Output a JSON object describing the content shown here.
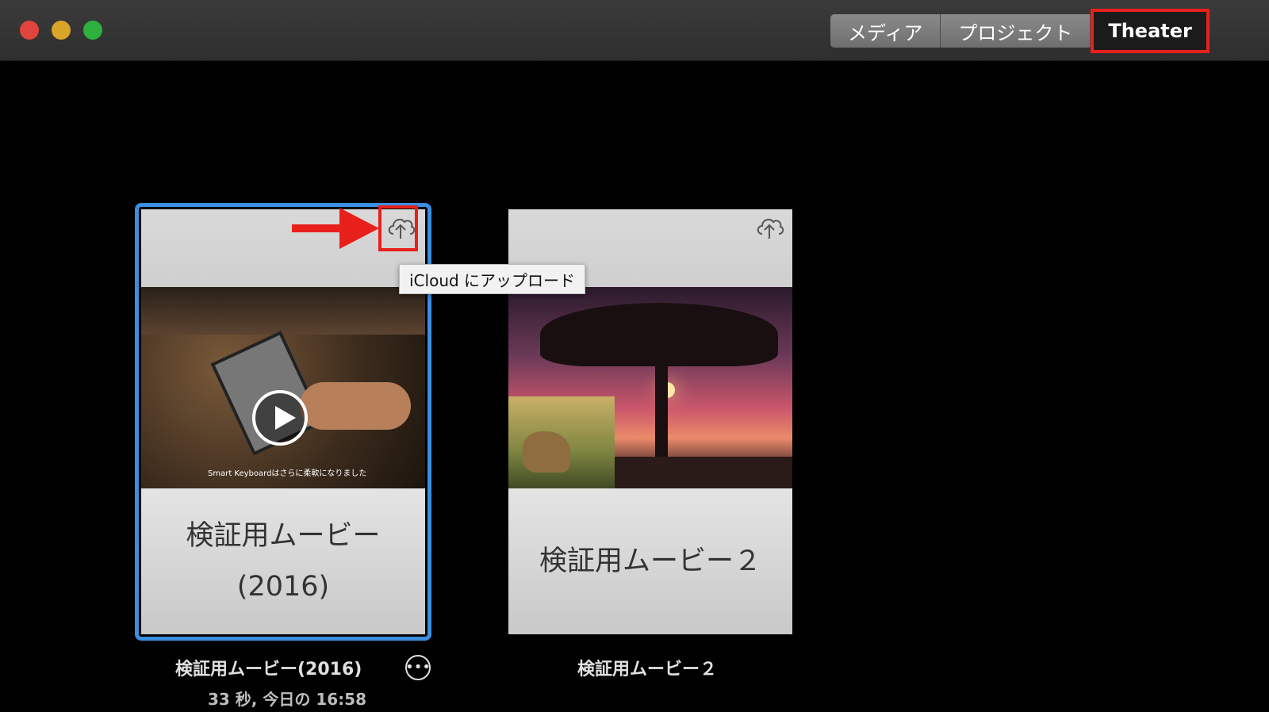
{
  "toolbar": {
    "tabs": [
      {
        "label": "メディア",
        "selected": false
      },
      {
        "label": "プロジェクト",
        "selected": false
      },
      {
        "label": "Theater",
        "selected": true
      }
    ]
  },
  "tooltip": {
    "text": "iCloud にアップロード"
  },
  "movies": [
    {
      "title_line1": "検証用ムービー",
      "title_line2": "(2016)",
      "name": "検証用ムービー(2016)",
      "meta": "33 秒, 今日の 16:58",
      "thumbnail_caption": "Smart Keyboardはさらに柔軟になりました"
    },
    {
      "title": "検証用ムービー２",
      "name": "検証用ムービー２"
    }
  ],
  "icons": {
    "upload": "cloud-upload-icon",
    "more": "ellipsis-circle-icon",
    "play": "play-icon"
  },
  "colors": {
    "highlight": "#e8201c",
    "selection": "#3a8fe0"
  }
}
